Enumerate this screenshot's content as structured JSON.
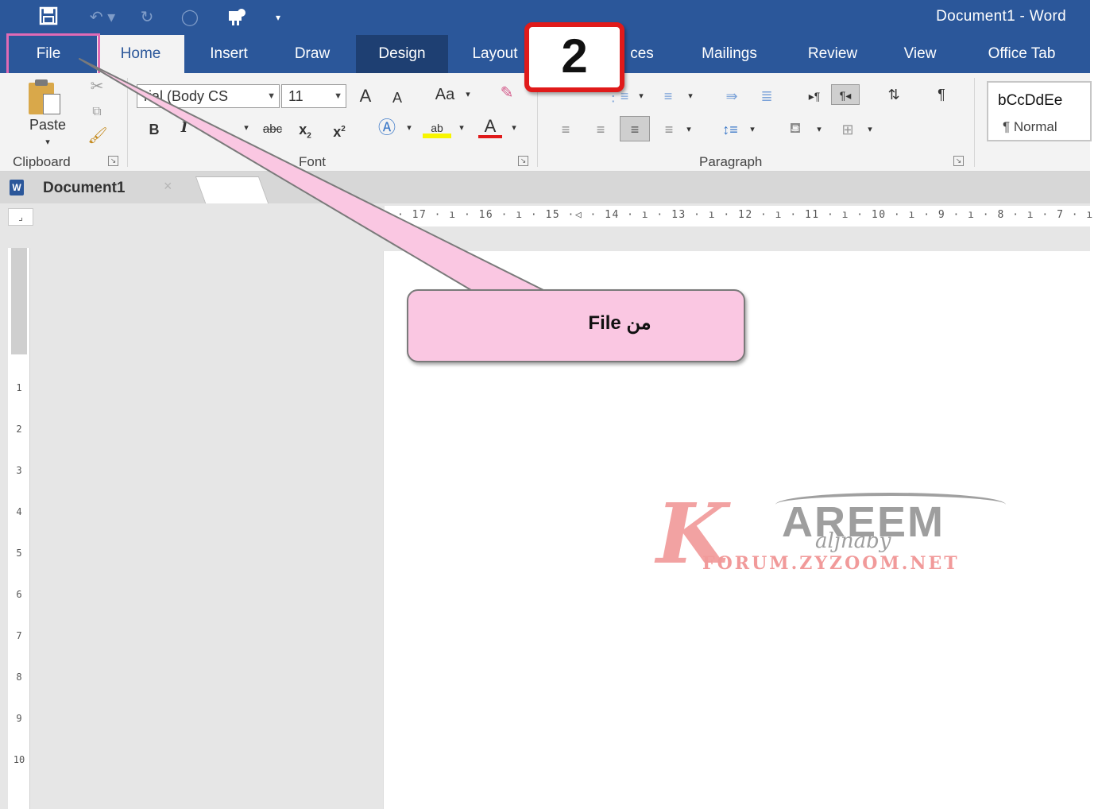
{
  "window": {
    "title": "Document1  -  Word",
    "qat_icons": [
      "save-icon",
      "undo-icon",
      "redo-icon",
      "circle-icon",
      "touch-mode-icon",
      "customize-qat-icon"
    ]
  },
  "tabs": [
    {
      "label": "File"
    },
    {
      "label": "Home"
    },
    {
      "label": "Insert"
    },
    {
      "label": "Draw"
    },
    {
      "label": "Design"
    },
    {
      "label": "Layout"
    },
    {
      "label": "ces"
    },
    {
      "label": "Mailings"
    },
    {
      "label": "Review"
    },
    {
      "label": "View"
    },
    {
      "label": "Office Tab"
    }
  ],
  "ribbon": {
    "clipboard": {
      "group_label": "Clipboard",
      "paste_label": "Paste"
    },
    "font": {
      "group_label": "Font",
      "font_name": "rial (Body CS",
      "font_size": "11",
      "grow": "A",
      "shrink": "A",
      "case": "Aa",
      "bold": "B",
      "italic": "I",
      "strike": "abc",
      "subscript": "x",
      "superscript": "x"
    },
    "paragraph": {
      "group_label": "Paragraph"
    },
    "styles": {
      "sample": "bCcDdEe",
      "name": "¶ Normal"
    }
  },
  "step_badge": "2",
  "document_tab": {
    "label": "Document1",
    "close": "×"
  },
  "ruler": {
    "horizontal": "· 17 · ı · 16 · ı · 15 ·◁ · 14 · ı · 13 · ı · 12 · ı · 11 · ı · 10 · ı · 9 · ı · 8 · ı · 7 · ı · 6 ·",
    "vertical": [
      "1",
      "2",
      "3",
      "4",
      "5",
      "6",
      "7",
      "8",
      "9",
      "10"
    ]
  },
  "callout": {
    "text": "File من"
  },
  "watermark": {
    "brand": "AREEM",
    "tagline": "aljnaby",
    "site": "FORUM.ZYZOOM.NET"
  },
  "colors": {
    "accent": "#2b579a",
    "callout_fill": "#fac7e2",
    "highlight": "#e06ab5",
    "badge_border": "#e01a1a"
  }
}
